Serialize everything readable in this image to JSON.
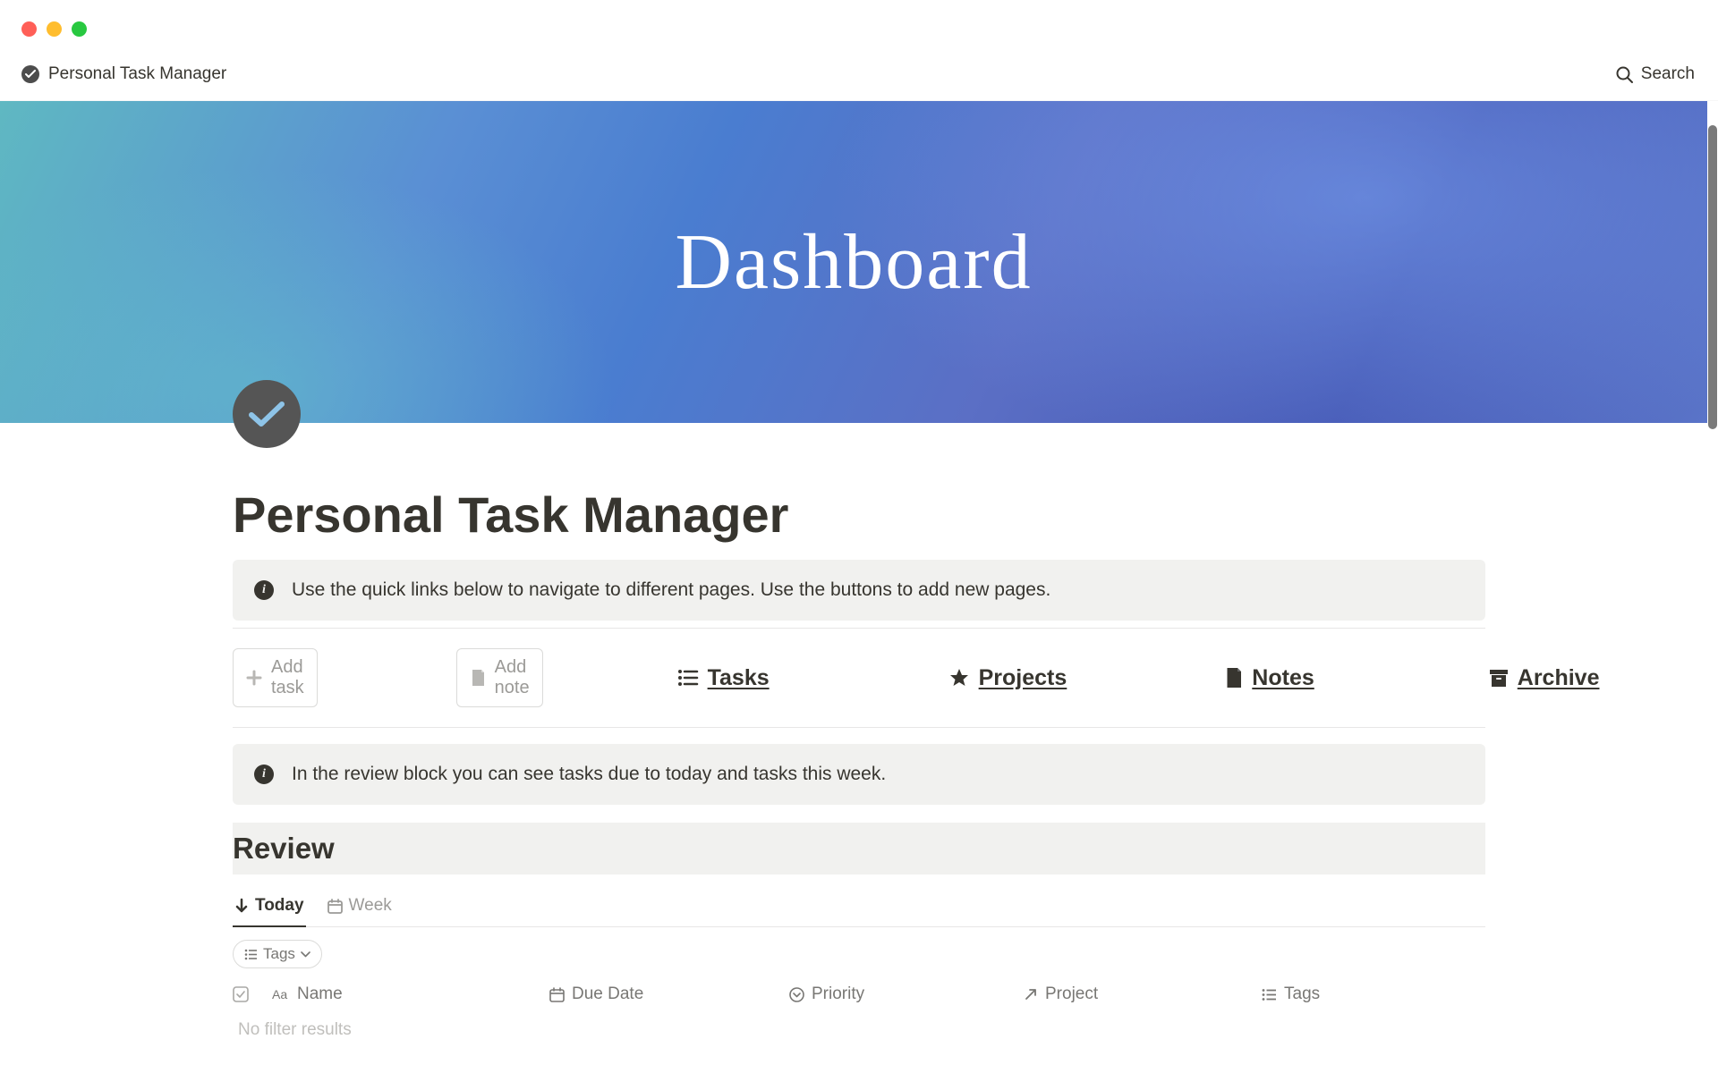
{
  "window": {
    "breadcrumb": "Personal Task Manager",
    "search_label": "Search"
  },
  "cover": {
    "title": "Dashboard"
  },
  "page": {
    "title": "Personal Task Manager"
  },
  "callouts": {
    "quick_links": "Use the quick links below to navigate to different pages. Use the buttons to add new pages.",
    "review_info": "In the review block you can see tasks due to today and tasks this week."
  },
  "buttons": {
    "add_task": "Add task",
    "add_note": "Add note"
  },
  "links": {
    "tasks": "Tasks",
    "projects": "Projects",
    "notes": "Notes",
    "archive": "Archive"
  },
  "review": {
    "title": "Review",
    "tabs": {
      "today": "Today",
      "week": "Week"
    },
    "filter": "Tags",
    "columns": {
      "name": "Name",
      "due_date": "Due Date",
      "priority": "Priority",
      "project": "Project",
      "tags": "Tags"
    },
    "empty_text": "No filter results"
  }
}
